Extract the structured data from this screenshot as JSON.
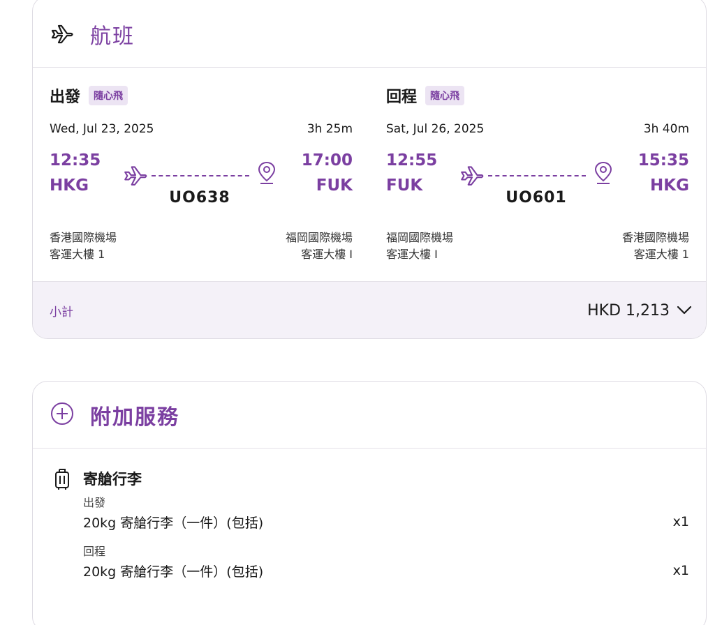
{
  "flight_card": {
    "title": "航班",
    "outbound": {
      "label": "出發",
      "badge": "隨心飛",
      "date": "Wed, Jul 23, 2025",
      "duration": "3h 25m",
      "dep_time": "12:35",
      "dep_code": "HKG",
      "arr_time": "17:00",
      "arr_code": "FUK",
      "flight_no": "UO638",
      "dep_airport": "香港國際機場",
      "dep_terminal": "客運大樓 1",
      "arr_airport": "福岡國際機場",
      "arr_terminal": "客運大樓 I"
    },
    "return": {
      "label": "回程",
      "badge": "隨心飛",
      "date": "Sat, Jul 26, 2025",
      "duration": "3h 40m",
      "dep_time": "12:55",
      "dep_code": "FUK",
      "arr_time": "15:35",
      "arr_code": "HKG",
      "flight_no": "UO601",
      "dep_airport": "福岡國際機場",
      "dep_terminal": "客運大樓 I",
      "arr_airport": "香港國際機場",
      "arr_terminal": "客運大樓 1"
    },
    "subtotal_label": "小計",
    "subtotal_amount": "HKD 1,213"
  },
  "addon_card": {
    "title": "附加服務",
    "baggage": {
      "title": "寄艙行李",
      "outbound_label": "出發",
      "outbound_item": "20kg 寄艙行李（一件）(包括)",
      "outbound_qty": "x1",
      "return_label": "回程",
      "return_item": "20kg 寄艙行李（一件）(包括)",
      "return_qty": "x1"
    }
  },
  "colors": {
    "accent": "#7b3fa1",
    "badge_bg": "#ece4f3",
    "subtotal_bg": "#f4f1f8"
  },
  "icons": [
    "airplane-icon",
    "location-pin-icon",
    "chevron-down-icon",
    "plus-circle-icon",
    "luggage-icon"
  ]
}
